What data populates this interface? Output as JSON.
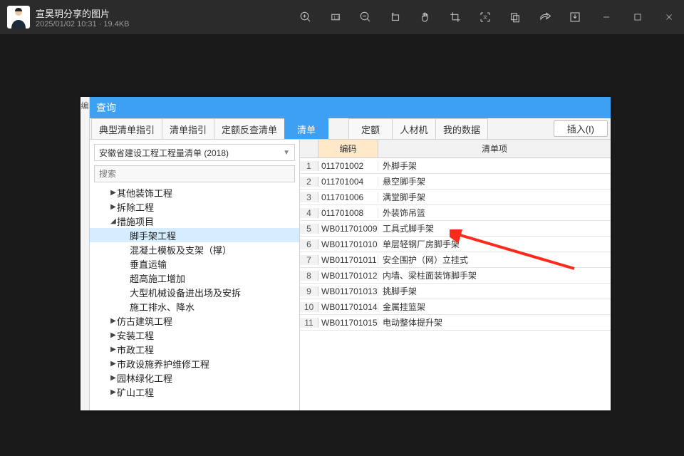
{
  "viewer": {
    "title": "宣昊玥分享的图片",
    "meta": "2025/01/02 10:31 · 19.4KB"
  },
  "app": {
    "sliver": "编",
    "title": "查询",
    "tabs": [
      "典型清单指引",
      "清单指引",
      "定额反查清单",
      "清单",
      "定额",
      "人材机",
      "我的数据"
    ],
    "active_tab_index": 3,
    "insert_btn": "插入(I)",
    "combo": "安徽省建设工程工程量清单 (2018)",
    "search_placeholder": "搜索",
    "tree": [
      {
        "level": 1,
        "caret": "▶",
        "label": "其他装饰工程"
      },
      {
        "level": 1,
        "caret": "▶",
        "label": "拆除工程"
      },
      {
        "level": 1,
        "caret": "◢",
        "label": "措施项目"
      },
      {
        "level": 2,
        "caret": "",
        "label": "脚手架工程",
        "selected": true
      },
      {
        "level": 2,
        "caret": "",
        "label": "混凝土模板及支架（撑）"
      },
      {
        "level": 2,
        "caret": "",
        "label": "垂直运输"
      },
      {
        "level": 2,
        "caret": "",
        "label": "超高施工增加"
      },
      {
        "level": 2,
        "caret": "",
        "label": "大型机械设备进出场及安拆"
      },
      {
        "level": 2,
        "caret": "",
        "label": "施工排水、降水"
      },
      {
        "level": 1,
        "caret": "▶",
        "label": "仿古建筑工程"
      },
      {
        "level": 1,
        "caret": "▶",
        "label": "安装工程"
      },
      {
        "level": 1,
        "caret": "▶",
        "label": "市政工程"
      },
      {
        "level": 1,
        "caret": "▶",
        "label": "市政设施养护维修工程"
      },
      {
        "level": 1,
        "caret": "▶",
        "label": "园林绿化工程"
      },
      {
        "level": 1,
        "caret": "▶",
        "label": "矿山工程"
      }
    ],
    "grid": {
      "head_code": "编码",
      "head_item": "清单项",
      "rows": [
        {
          "n": "1",
          "code": "011701002",
          "item": "外脚手架"
        },
        {
          "n": "2",
          "code": "011701004",
          "item": "悬空脚手架"
        },
        {
          "n": "3",
          "code": "011701006",
          "item": "满堂脚手架"
        },
        {
          "n": "4",
          "code": "011701008",
          "item": "外装饰吊篮"
        },
        {
          "n": "5",
          "code": "WB011701009",
          "item": "工具式脚手架"
        },
        {
          "n": "6",
          "code": "WB011701010",
          "item": "单层轻钢厂房脚手架"
        },
        {
          "n": "7",
          "code": "WB011701011",
          "item": "安全围护（网）立挂式"
        },
        {
          "n": "8",
          "code": "WB011701012",
          "item": "内墙、梁柱面装饰脚手架"
        },
        {
          "n": "9",
          "code": "WB011701013",
          "item": "挑脚手架"
        },
        {
          "n": "10",
          "code": "WB011701014",
          "item": "金属挂篮架"
        },
        {
          "n": "11",
          "code": "WB011701015",
          "item": "电动整体提升架"
        }
      ]
    }
  }
}
